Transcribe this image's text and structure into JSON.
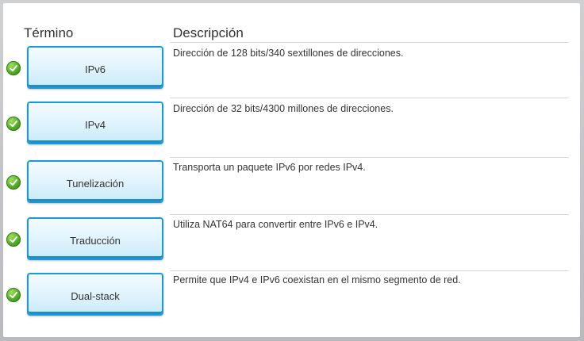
{
  "headers": {
    "term": "Término",
    "description": "Descripción"
  },
  "rows": [
    {
      "term": "IPv6",
      "description": "Dirección de 128 bits/340 sextillones de direcciones.",
      "status": "correct"
    },
    {
      "term": "IPv4",
      "description": "Dirección de 32 bits/4300 millones de direcciones.",
      "status": "correct"
    },
    {
      "term": "Tunelización",
      "description": "Transporta un paquete IPv6 por redes IPv4.",
      "status": "correct"
    },
    {
      "term": "Traducción",
      "description": "Utiliza NAT64 para convertir entre IPv6 e IPv4.",
      "status": "correct"
    },
    {
      "term": "Dual-stack",
      "description": "Permite que IPv4 e IPv6 coexistan en el mismo segmento de red.",
      "status": "correct"
    }
  ],
  "colors": {
    "button_border": "#1a9bd8",
    "check_green": "#3e9e19"
  },
  "icons": {
    "status": "check-circle-icon"
  }
}
